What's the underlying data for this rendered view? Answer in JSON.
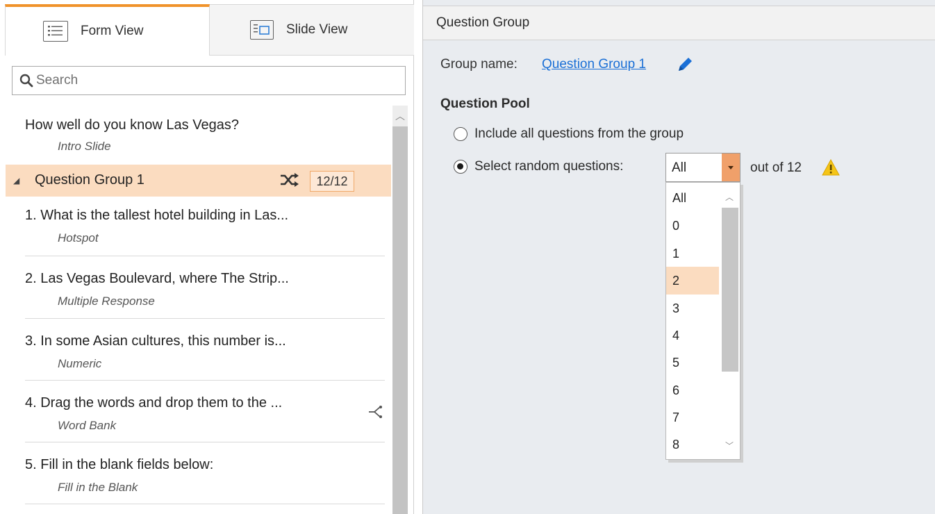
{
  "left_panel": {
    "tabs": [
      {
        "label": "Form View",
        "icon": "list-icon",
        "active": true
      },
      {
        "label": "Slide View",
        "icon": "slide-icon",
        "active": false
      }
    ],
    "search": {
      "placeholder": "Search",
      "value": ""
    },
    "intro": {
      "title": "How well do you know Las Vegas?",
      "subtitle": "Intro Slide"
    },
    "group": {
      "title": "Question Group 1",
      "count": "12/12",
      "icons": [
        "collapse-triangle-icon",
        "shuffle-icon"
      ]
    },
    "items": [
      {
        "title": "1. What is the tallest hotel building in Las...",
        "subtitle": "Hotspot"
      },
      {
        "title": "2. Las Vegas Boulevard, where The Strip...",
        "subtitle": "Multiple Response"
      },
      {
        "title": "3. In some Asian cultures, this number is...",
        "subtitle": "Numeric"
      },
      {
        "title": "4. Drag the words and drop them to the ...",
        "subtitle": "Word Bank",
        "icon": "branching-icon"
      },
      {
        "title": "5. Fill in the blank fields below:",
        "subtitle": "Fill in the Blank"
      }
    ]
  },
  "right_panel": {
    "header": "Question Group",
    "group_name_label": "Group name:",
    "group_name_value": "Question Group 1",
    "pool_title": "Question Pool",
    "option_all": "Include all questions from the group",
    "option_random": "Select random questions:",
    "selected_value": "All",
    "out_of_label": "out of 12",
    "warning_icon": "warning-icon",
    "dropdown_options": [
      "All",
      "0",
      "1",
      "2",
      "3",
      "4",
      "5",
      "6",
      "7",
      "8"
    ],
    "highlighted_option": "2"
  },
  "colors": {
    "accent_orange": "#f0932b",
    "highlight": "#fbdcc0",
    "link_blue": "#1a6fd6",
    "warning_yellow": "#f5c518"
  }
}
